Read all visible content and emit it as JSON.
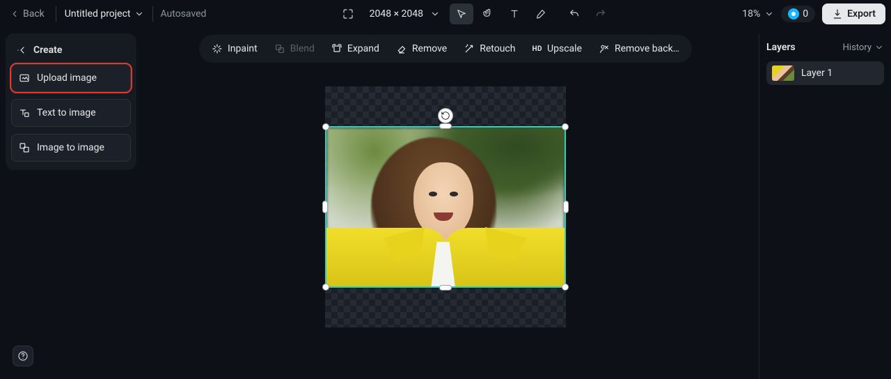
{
  "topbar": {
    "back_label": "Back",
    "project_title": "Untitled project",
    "autosaved_label": "Autosaved",
    "canvas_size": "2048 × 2048",
    "zoom": "18%",
    "credits": "0",
    "export_label": "Export"
  },
  "left_panel": {
    "header": "Create",
    "items": [
      {
        "label": "Upload image"
      },
      {
        "label": "Text to image"
      },
      {
        "label": "Image to image"
      }
    ]
  },
  "action_bar": {
    "inpaint": "Inpaint",
    "blend": "Blend",
    "expand": "Expand",
    "remove": "Remove",
    "retouch": "Retouch",
    "upscale": "Upscale",
    "remove_bg": "Remove back…"
  },
  "right_panel": {
    "title": "Layers",
    "history_label": "History",
    "layers": [
      {
        "name": "Layer 1"
      }
    ]
  },
  "colors": {
    "selection": "#27d3c3",
    "highlight": "#e7352c",
    "accent_blue": "#14b8ff"
  }
}
